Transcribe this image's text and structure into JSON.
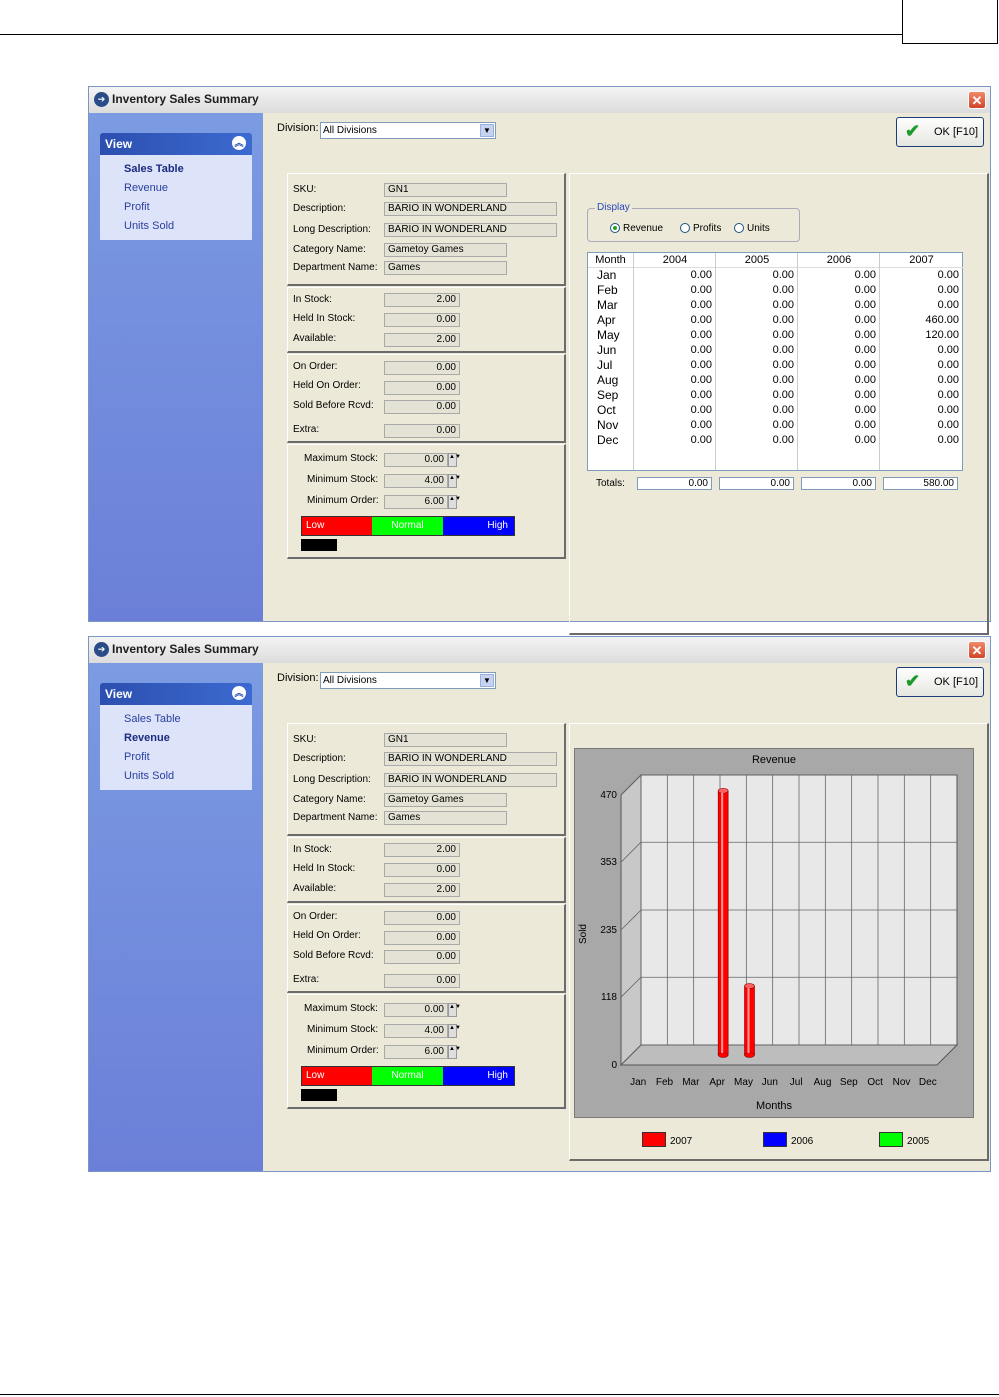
{
  "window_title": "Inventory Sales Summary",
  "view": {
    "header": "View",
    "items": [
      "Sales Table",
      "Revenue",
      "Profit",
      "Units Sold"
    ]
  },
  "division": {
    "label": "Division:",
    "value": "All Divisions"
  },
  "ok_button": "OK [F10]",
  "item_info": {
    "sku_label": "SKU:",
    "sku": "GN1",
    "description_label": "Description:",
    "description": "BARIO IN WONDERLAND",
    "long_description_label": "Long Description:",
    "long_description": "BARIO IN WONDERLAND",
    "category_label": "Category Name:",
    "category": "Gametoy Games",
    "department_label": "Department Name:",
    "department": "Games"
  },
  "stock": {
    "in_stock_label": "In Stock:",
    "in_stock": "2.00",
    "held_in_stock_label": "Held In Stock:",
    "held_in_stock": "0.00",
    "available_label": "Available:",
    "available": "2.00"
  },
  "orders": {
    "on_order_label": "On Order:",
    "on_order": "0.00",
    "held_on_order_label": "Held On Order:",
    "held_on_order": "0.00",
    "sold_before_rcvd_label": "Sold Before Rcvd:",
    "sold_before_rcvd": "0.00",
    "extra_label": "Extra:",
    "extra": "0.00"
  },
  "levels": {
    "max_stock_label": "Maximum Stock:",
    "max_stock": "0.00",
    "min_stock_label": "Minimum Stock:",
    "min_stock": "4.00",
    "min_order_label": "Minimum Order:",
    "min_order": "6.00",
    "low": "Low",
    "normal": "Normal",
    "high": "High",
    "colors": {
      "low": "#ff0000",
      "normal": "#00ff00",
      "high": "#0000ff"
    }
  },
  "display": {
    "legend": "Display",
    "options": [
      "Revenue",
      "Profits",
      "Units"
    ],
    "selected": "Revenue"
  },
  "sales_table": {
    "month_header": "Month",
    "years": [
      "2004",
      "2005",
      "2006",
      "2007"
    ],
    "months": [
      "Jan",
      "Feb",
      "Mar",
      "Apr",
      "May",
      "Jun",
      "Jul",
      "Aug",
      "Sep",
      "Oct",
      "Nov",
      "Dec"
    ],
    "rows": [
      [
        "0.00",
        "0.00",
        "0.00",
        "0.00"
      ],
      [
        "0.00",
        "0.00",
        "0.00",
        "0.00"
      ],
      [
        "0.00",
        "0.00",
        "0.00",
        "0.00"
      ],
      [
        "0.00",
        "0.00",
        "0.00",
        "460.00"
      ],
      [
        "0.00",
        "0.00",
        "0.00",
        "120.00"
      ],
      [
        "0.00",
        "0.00",
        "0.00",
        "0.00"
      ],
      [
        "0.00",
        "0.00",
        "0.00",
        "0.00"
      ],
      [
        "0.00",
        "0.00",
        "0.00",
        "0.00"
      ],
      [
        "0.00",
        "0.00",
        "0.00",
        "0.00"
      ],
      [
        "0.00",
        "0.00",
        "0.00",
        "0.00"
      ],
      [
        "0.00",
        "0.00",
        "0.00",
        "0.00"
      ],
      [
        "0.00",
        "0.00",
        "0.00",
        "0.00"
      ]
    ],
    "totals_label": "Totals:",
    "totals": [
      "0.00",
      "0.00",
      "0.00",
      "580.00"
    ]
  },
  "chart_data": {
    "type": "bar",
    "title": "Revenue",
    "xlabel": "Months",
    "ylabel": "Sold",
    "categories": [
      "Jan",
      "Feb",
      "Mar",
      "Apr",
      "May",
      "Jun",
      "Jul",
      "Aug",
      "Sep",
      "Oct",
      "Nov",
      "Dec"
    ],
    "yticks": [
      "0",
      "118",
      "235",
      "353",
      "470"
    ],
    "ylim": [
      0,
      470
    ],
    "series": [
      {
        "name": "2007",
        "color": "#ff0000",
        "values": [
          0,
          0,
          0,
          460,
          120,
          0,
          0,
          0,
          0,
          0,
          0,
          0
        ]
      },
      {
        "name": "2006",
        "color": "#0000ff",
        "values": [
          0,
          0,
          0,
          0,
          0,
          0,
          0,
          0,
          0,
          0,
          0,
          0
        ]
      },
      {
        "name": "2005",
        "color": "#00ff00",
        "values": [
          0,
          0,
          0,
          0,
          0,
          0,
          0,
          0,
          0,
          0,
          0,
          0
        ]
      }
    ],
    "grid": true,
    "legend_position": "bottom"
  }
}
